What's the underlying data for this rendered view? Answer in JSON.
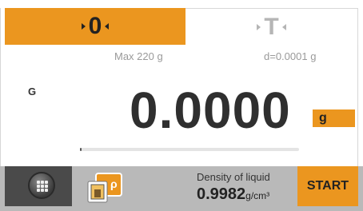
{
  "keys": {
    "zero_label": "0",
    "tare_label": "T"
  },
  "info": {
    "max_capacity": "Max 220 g",
    "readability": "d=0.0001 g"
  },
  "display": {
    "mode_indicator": "G",
    "weight": "0.0000",
    "unit": "g",
    "capacity_progress": 0.0
  },
  "bottom": {
    "density_label": "Density of liquid",
    "density_value": "0.9982",
    "density_unit": "g/cm³",
    "start_label": "START"
  },
  "icons": [
    "menu-grid-icon",
    "density-application-icon",
    "arrow-right-icon",
    "arrow-left-icon"
  ],
  "colors": {
    "accent": "#eb961f",
    "bottom_bar": "#b9b9b9",
    "menu_bg": "#4a4a4a"
  }
}
